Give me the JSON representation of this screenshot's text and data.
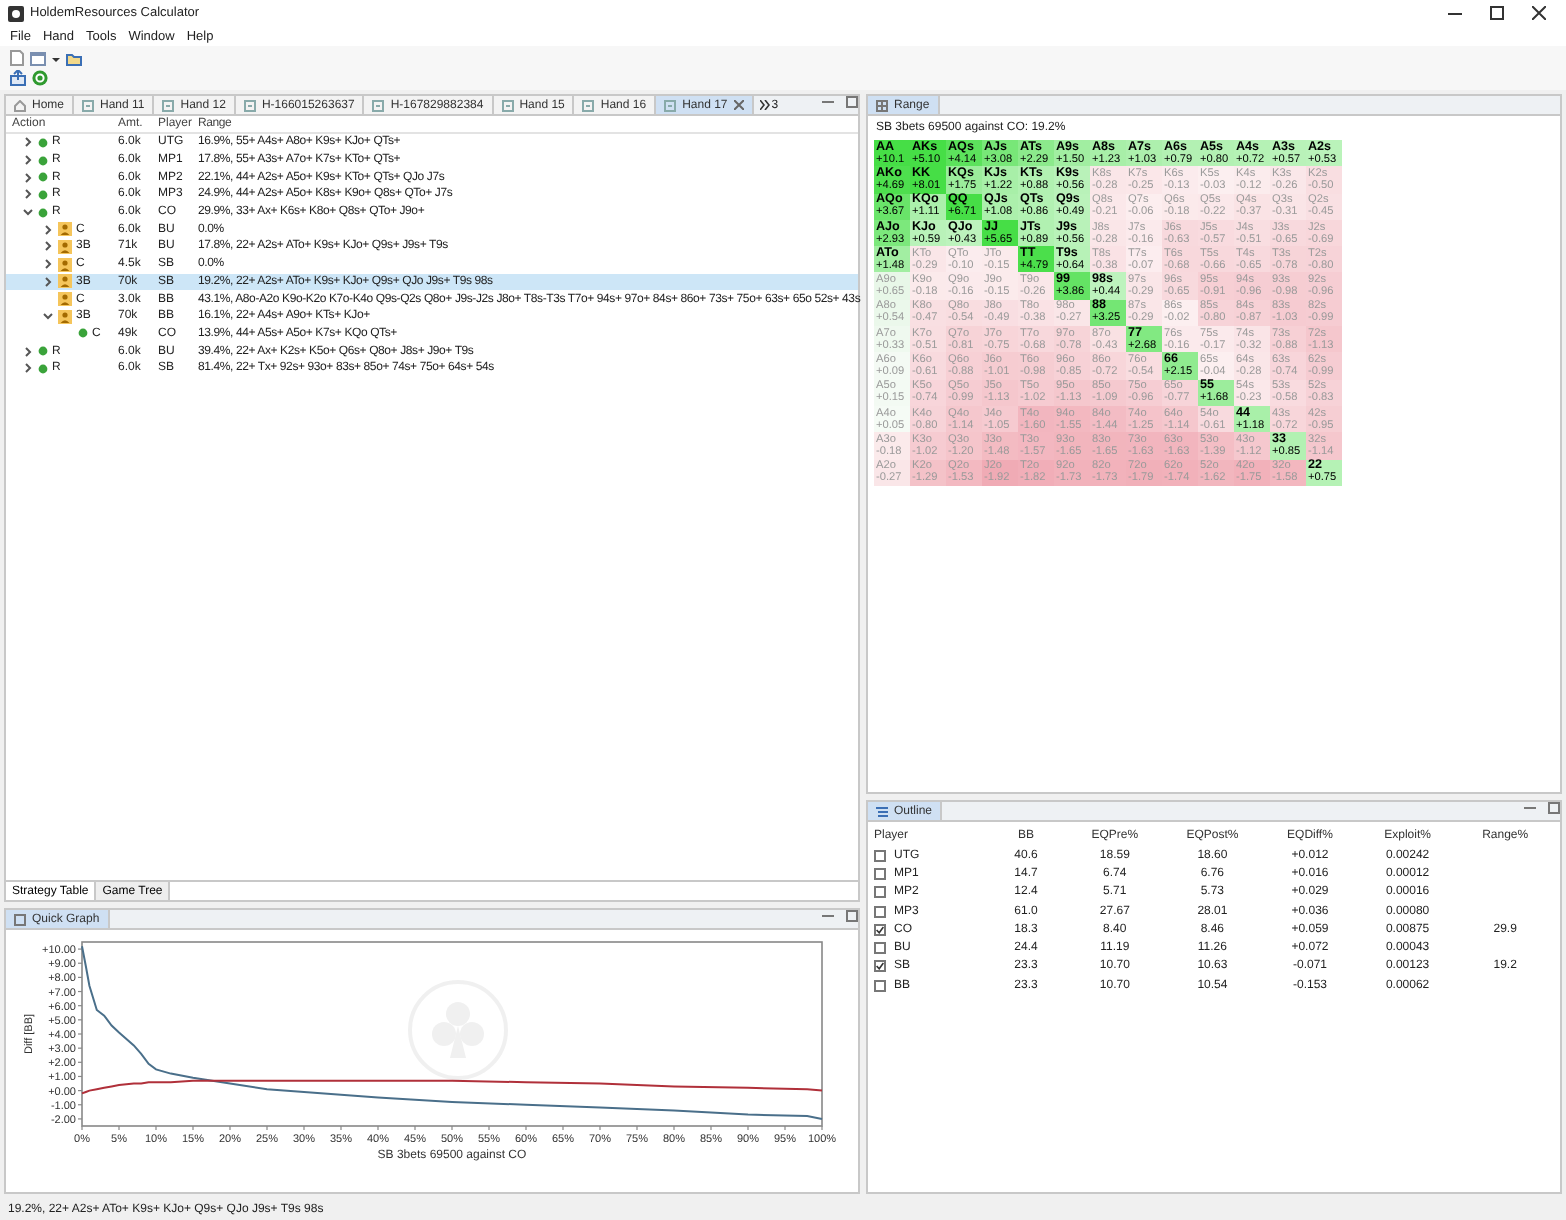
{
  "window": {
    "title": "HoldemResources Calculator"
  },
  "menu": [
    "File",
    "Hand",
    "Tools",
    "Window",
    "Help"
  ],
  "tabs": [
    {
      "label": "Home",
      "selected": false
    },
    {
      "label": "Hand 11",
      "selected": false
    },
    {
      "label": "Hand 12",
      "selected": false
    },
    {
      "label": "H-166015263637",
      "selected": false
    },
    {
      "label": "H-167829882384",
      "selected": false
    },
    {
      "label": "Hand 15",
      "selected": false
    },
    {
      "label": "Hand 16",
      "selected": false
    },
    {
      "label": "Hand 17",
      "selected": true
    }
  ],
  "tab_overflow": "3",
  "strategy_table": {
    "columns": [
      "Action",
      "Amt.",
      "Player",
      "Range"
    ],
    "rows": [
      {
        "kind": "dot",
        "action": "R",
        "amt": "6.0k",
        "player": "UTG",
        "range": "16.9%, 55+ A4s+ A8o+ K9s+ KJo+ QTs+",
        "expanded": false,
        "selected": false
      },
      {
        "kind": "dot",
        "action": "R",
        "amt": "6.0k",
        "player": "MP1",
        "range": "17.8%, 55+ A3s+ A7o+ K7s+ KTo+ QTs+",
        "expanded": false,
        "selected": false
      },
      {
        "kind": "dot",
        "action": "R",
        "amt": "6.0k",
        "player": "MP2",
        "range": "22.1%, 44+ A2s+ A5o+ K9s+ KTo+ QTs+ QJo J7s",
        "expanded": false,
        "selected": false
      },
      {
        "kind": "dot",
        "action": "R",
        "amt": "6.0k",
        "player": "MP3",
        "range": "24.9%, 44+ A2s+ A5o+ K8s+ K9o+ Q8s+ QTo+ J7s",
        "expanded": false,
        "selected": false
      },
      {
        "kind": "dot",
        "action": "R",
        "amt": "6.0k",
        "player": "CO",
        "range": "29.9%, 33+ Ax+ K6s+ K8o+ Q8s+ QTo+ J9o+",
        "expanded": true,
        "selected": false,
        "children": [
          {
            "kind": "person",
            "action": "C",
            "amt": "6.0k",
            "player": "BU",
            "range": "0.0%",
            "expanded": false,
            "selected": false
          },
          {
            "kind": "person",
            "action": "3B",
            "amt": "71k",
            "player": "BU",
            "range": "17.8%, 22+ A2s+ ATo+ K9s+ KJo+ Q9s+ J9s+ T9s",
            "expanded": false,
            "selected": false
          },
          {
            "kind": "person",
            "action": "C",
            "amt": "4.5k",
            "player": "SB",
            "range": "0.0%",
            "expanded": false,
            "selected": false
          },
          {
            "kind": "person",
            "action": "3B",
            "amt": "70k",
            "player": "SB",
            "range": "19.2%, 22+ A2s+ ATo+ K9s+ KJo+ Q9s+ QJo J9s+ T9s 98s",
            "expanded": false,
            "selected": true
          },
          {
            "kind": "person",
            "action": "C",
            "amt": "3.0k",
            "player": "BB",
            "range": "43.1%, A8o-A2o K9o-K2o K7o-K4o Q9s-Q2s Q8o+ J9s-J2s J8o+ T8s-T3s T7o+ 94s+ 97o+ 84s+ 86o+ 73s+ 75o+ 63s+ 65o 52s+ 43s",
            "selected": false
          },
          {
            "kind": "person",
            "action": "3B",
            "amt": "70k",
            "player": "BB",
            "range": "16.1%, 22+ A4s+ A9o+ KTs+ KJo+",
            "expanded": true,
            "selected": false,
            "children": [
              {
                "kind": "dot",
                "action": "C",
                "amt": "49k",
                "player": "CO",
                "range": "13.9%, 44+ A5s+ A5o+ K7s+ KQo QTs+",
                "selected": false
              }
            ]
          }
        ]
      },
      {
        "kind": "dot",
        "action": "R",
        "amt": "6.0k",
        "player": "BU",
        "range": "39.4%, 22+ Ax+ K2s+ K5o+ Q6s+ Q8o+ J8s+ J9o+ T9s",
        "expanded": false,
        "selected": false
      },
      {
        "kind": "dot",
        "action": "R",
        "amt": "6.0k",
        "player": "SB",
        "range": "81.4%, 22+ Tx+ 92s+ 93o+ 83s+ 85o+ 74s+ 75o+ 64s+ 54s",
        "expanded": false,
        "selected": false
      }
    ]
  },
  "bottom_tabs": [
    {
      "label": "Strategy Table",
      "selected": true
    },
    {
      "label": "Game Tree",
      "selected": false
    }
  ],
  "quick_graph": {
    "title": "Quick Graph",
    "chart_data": {
      "type": "line",
      "xlabel": "SB 3bets 69500 against CO",
      "ylabel": "Diff [BB]",
      "xlim": [
        0,
        100
      ],
      "ylim": [
        -2.5,
        10.5
      ],
      "xticks": [
        {
          "value": 0,
          "label": "0%"
        },
        {
          "value": 5,
          "label": "5%"
        },
        {
          "value": 10,
          "label": "10%"
        },
        {
          "value": 15,
          "label": "15%"
        },
        {
          "value": 20,
          "label": "20%"
        },
        {
          "value": 25,
          "label": "25%"
        },
        {
          "value": 30,
          "label": "30%"
        },
        {
          "value": 35,
          "label": "35%"
        },
        {
          "value": 40,
          "label": "40%"
        },
        {
          "value": 45,
          "label": "45%"
        },
        {
          "value": 50,
          "label": "50%"
        },
        {
          "value": 55,
          "label": "55%"
        },
        {
          "value": 60,
          "label": "60%"
        },
        {
          "value": 65,
          "label": "65%"
        },
        {
          "value": 70,
          "label": "70%"
        },
        {
          "value": 75,
          "label": "75%"
        },
        {
          "value": 80,
          "label": "80%"
        },
        {
          "value": 85,
          "label": "85%"
        },
        {
          "value": 90,
          "label": "90%"
        },
        {
          "value": 95,
          "label": "95%"
        },
        {
          "value": 100,
          "label": "100%"
        }
      ],
      "yticks": [
        {
          "value": 10,
          "label": "+10.00"
        },
        {
          "value": 9,
          "label": "+9.00"
        },
        {
          "value": 8,
          "label": "+8.00"
        },
        {
          "value": 7,
          "label": "+7.00"
        },
        {
          "value": 6,
          "label": "+6.00"
        },
        {
          "value": 5,
          "label": "+5.00"
        },
        {
          "value": 4,
          "label": "+4.00"
        },
        {
          "value": 3,
          "label": "+3.00"
        },
        {
          "value": 2,
          "label": "+2.00"
        },
        {
          "value": 1,
          "label": "+1.00"
        },
        {
          "value": 0,
          "label": "+0.00"
        },
        {
          "value": -1,
          "label": "-1.00"
        },
        {
          "value": -2,
          "label": "-2.00"
        }
      ],
      "x": [
        0,
        0.5,
        1,
        2,
        3,
        4,
        5,
        7,
        8,
        9,
        10,
        12,
        15,
        20,
        25,
        30,
        40,
        50,
        60,
        70,
        80,
        90,
        98,
        100
      ],
      "series": [
        {
          "color": "#4a6f8a",
          "values": [
            10.2,
            8.8,
            7.4,
            5.7,
            5.3,
            4.6,
            4.1,
            3.2,
            2.6,
            1.9,
            1.5,
            1.2,
            0.9,
            0.5,
            0.1,
            -0.1,
            -0.5,
            -0.8,
            -1.0,
            -1.2,
            -1.4,
            -1.7,
            -1.8,
            -2.0
          ]
        },
        {
          "color": "#b0303a",
          "values": [
            -0.2,
            -0.1,
            0.0,
            0.1,
            0.2,
            0.3,
            0.4,
            0.5,
            0.5,
            0.6,
            0.6,
            0.6,
            0.7,
            0.7,
            0.7,
            0.7,
            0.7,
            0.7,
            0.6,
            0.5,
            0.3,
            0.2,
            0.1,
            0.0
          ]
        }
      ]
    }
  },
  "status_bar": "19.2%, 22+ A2s+ ATo+ K9s+ KJo+ Q9s+ QJo J9s+ T9s 98s",
  "range": {
    "title": "Range",
    "subtitle": "SB 3bets 69500 against CO: 19.2%",
    "grid": [
      [
        {
          "hand": "AA",
          "ev": "+10.1",
          "in_range": true
        },
        {
          "hand": "AKs",
          "ev": "+5.10",
          "in_range": true
        },
        {
          "hand": "AQs",
          "ev": "+4.14",
          "in_range": true
        },
        {
          "hand": "AJs",
          "ev": "+3.08",
          "in_range": true
        },
        {
          "hand": "ATs",
          "ev": "+2.29",
          "in_range": true
        },
        {
          "hand": "A9s",
          "ev": "+1.50",
          "in_range": true
        },
        {
          "hand": "A8s",
          "ev": "+1.23",
          "in_range": true
        },
        {
          "hand": "A7s",
          "ev": "+1.03",
          "in_range": true
        },
        {
          "hand": "A6s",
          "ev": "+0.79",
          "in_range": true
        },
        {
          "hand": "A5s",
          "ev": "+0.80",
          "in_range": true
        },
        {
          "hand": "A4s",
          "ev": "+0.72",
          "in_range": true
        },
        {
          "hand": "A3s",
          "ev": "+0.57",
          "in_range": true
        },
        {
          "hand": "A2s",
          "ev": "+0.53",
          "in_range": true
        }
      ],
      [
        {
          "hand": "AKo",
          "ev": "+4.69",
          "in_range": true
        },
        {
          "hand": "KK",
          "ev": "+8.01",
          "in_range": true
        },
        {
          "hand": "KQs",
          "ev": "+1.75",
          "in_range": true
        },
        {
          "hand": "KJs",
          "ev": "+1.22",
          "in_range": true
        },
        {
          "hand": "KTs",
          "ev": "+0.88",
          "in_range": true
        },
        {
          "hand": "K9s",
          "ev": "+0.56",
          "in_range": true
        },
        {
          "hand": "K8s",
          "ev": "-0.28",
          "in_range": false
        },
        {
          "hand": "K7s",
          "ev": "-0.25",
          "in_range": false
        },
        {
          "hand": "K6s",
          "ev": "-0.13",
          "in_range": false
        },
        {
          "hand": "K5s",
          "ev": "-0.03",
          "in_range": false
        },
        {
          "hand": "K4s",
          "ev": "-0.12",
          "in_range": false
        },
        {
          "hand": "K3s",
          "ev": "-0.26",
          "in_range": false
        },
        {
          "hand": "K2s",
          "ev": "-0.50",
          "in_range": false
        }
      ],
      [
        {
          "hand": "AQo",
          "ev": "+3.67",
          "in_range": true
        },
        {
          "hand": "KQo",
          "ev": "+1.11",
          "in_range": true
        },
        {
          "hand": "QQ",
          "ev": "+6.71",
          "in_range": true
        },
        {
          "hand": "QJs",
          "ev": "+1.08",
          "in_range": true
        },
        {
          "hand": "QTs",
          "ev": "+0.86",
          "in_range": true
        },
        {
          "hand": "Q9s",
          "ev": "+0.49",
          "in_range": true
        },
        {
          "hand": "Q8s",
          "ev": "-0.21",
          "in_range": false
        },
        {
          "hand": "Q7s",
          "ev": "-0.06",
          "in_range": false
        },
        {
          "hand": "Q6s",
          "ev": "-0.18",
          "in_range": false
        },
        {
          "hand": "Q5s",
          "ev": "-0.22",
          "in_range": false
        },
        {
          "hand": "Q4s",
          "ev": "-0.37",
          "in_range": false
        },
        {
          "hand": "Q3s",
          "ev": "-0.31",
          "in_range": false
        },
        {
          "hand": "Q2s",
          "ev": "-0.45",
          "in_range": false
        }
      ],
      [
        {
          "hand": "AJo",
          "ev": "+2.93",
          "in_range": true
        },
        {
          "hand": "KJo",
          "ev": "+0.59",
          "in_range": true
        },
        {
          "hand": "QJo",
          "ev": "+0.43",
          "in_range": true
        },
        {
          "hand": "JJ",
          "ev": "+5.65",
          "in_range": true
        },
        {
          "hand": "JTs",
          "ev": "+0.89",
          "in_range": true
        },
        {
          "hand": "J9s",
          "ev": "+0.56",
          "in_range": true
        },
        {
          "hand": "J8s",
          "ev": "-0.28",
          "in_range": false
        },
        {
          "hand": "J7s",
          "ev": "-0.16",
          "in_range": false
        },
        {
          "hand": "J6s",
          "ev": "-0.63",
          "in_range": false
        },
        {
          "hand": "J5s",
          "ev": "-0.57",
          "in_range": false
        },
        {
          "hand": "J4s",
          "ev": "-0.51",
          "in_range": false
        },
        {
          "hand": "J3s",
          "ev": "-0.65",
          "in_range": false
        },
        {
          "hand": "J2s",
          "ev": "-0.69",
          "in_range": false
        }
      ],
      [
        {
          "hand": "ATo",
          "ev": "+1.48",
          "in_range": true
        },
        {
          "hand": "KTo",
          "ev": "-0.29",
          "in_range": false
        },
        {
          "hand": "QTo",
          "ev": "-0.10",
          "in_range": false
        },
        {
          "hand": "JTo",
          "ev": "-0.15",
          "in_range": false
        },
        {
          "hand": "TT",
          "ev": "+4.79",
          "in_range": true
        },
        {
          "hand": "T9s",
          "ev": "+0.64",
          "in_range": true
        },
        {
          "hand": "T8s",
          "ev": "-0.38",
          "in_range": false
        },
        {
          "hand": "T7s",
          "ev": "-0.07",
          "in_range": false
        },
        {
          "hand": "T6s",
          "ev": "-0.68",
          "in_range": false
        },
        {
          "hand": "T5s",
          "ev": "-0.66",
          "in_range": false
        },
        {
          "hand": "T4s",
          "ev": "-0.65",
          "in_range": false
        },
        {
          "hand": "T3s",
          "ev": "-0.78",
          "in_range": false
        },
        {
          "hand": "T2s",
          "ev": "-0.80",
          "in_range": false
        }
      ],
      [
        {
          "hand": "A9o",
          "ev": "+0.65",
          "in_range": false
        },
        {
          "hand": "K9o",
          "ev": "-0.18",
          "in_range": false
        },
        {
          "hand": "Q9o",
          "ev": "-0.16",
          "in_range": false
        },
        {
          "hand": "J9o",
          "ev": "-0.15",
          "in_range": false
        },
        {
          "hand": "T9o",
          "ev": "-0.26",
          "in_range": false
        },
        {
          "hand": "99",
          "ev": "+3.86",
          "in_range": true
        },
        {
          "hand": "98s",
          "ev": "+0.44",
          "in_range": true
        },
        {
          "hand": "97s",
          "ev": "-0.29",
          "in_range": false
        },
        {
          "hand": "96s",
          "ev": "-0.65",
          "in_range": false
        },
        {
          "hand": "95s",
          "ev": "-0.91",
          "in_range": false
        },
        {
          "hand": "94s",
          "ev": "-0.96",
          "in_range": false
        },
        {
          "hand": "93s",
          "ev": "-0.98",
          "in_range": false
        },
        {
          "hand": "92s",
          "ev": "-0.96",
          "in_range": false
        }
      ],
      [
        {
          "hand": "A8o",
          "ev": "+0.54",
          "in_range": false
        },
        {
          "hand": "K8o",
          "ev": "-0.47",
          "in_range": false
        },
        {
          "hand": "Q8o",
          "ev": "-0.54",
          "in_range": false
        },
        {
          "hand": "J8o",
          "ev": "-0.49",
          "in_range": false
        },
        {
          "hand": "T8o",
          "ev": "-0.38",
          "in_range": false
        },
        {
          "hand": "98o",
          "ev": "-0.27",
          "in_range": false
        },
        {
          "hand": "88",
          "ev": "+3.25",
          "in_range": true
        },
        {
          "hand": "87s",
          "ev": "-0.29",
          "in_range": false
        },
        {
          "hand": "86s",
          "ev": "-0.02",
          "in_range": false
        },
        {
          "hand": "85s",
          "ev": "-0.80",
          "in_range": false
        },
        {
          "hand": "84s",
          "ev": "-0.87",
          "in_range": false
        },
        {
          "hand": "83s",
          "ev": "-1.03",
          "in_range": false
        },
        {
          "hand": "82s",
          "ev": "-0.99",
          "in_range": false
        }
      ],
      [
        {
          "hand": "A7o",
          "ev": "+0.33",
          "in_range": false
        },
        {
          "hand": "K7o",
          "ev": "-0.51",
          "in_range": false
        },
        {
          "hand": "Q7o",
          "ev": "-0.81",
          "in_range": false
        },
        {
          "hand": "J7o",
          "ev": "-0.75",
          "in_range": false
        },
        {
          "hand": "T7o",
          "ev": "-0.68",
          "in_range": false
        },
        {
          "hand": "97o",
          "ev": "-0.78",
          "in_range": false
        },
        {
          "hand": "87o",
          "ev": "-0.43",
          "in_range": false
        },
        {
          "hand": "77",
          "ev": "+2.68",
          "in_range": true
        },
        {
          "hand": "76s",
          "ev": "-0.16",
          "in_range": false
        },
        {
          "hand": "75s",
          "ev": "-0.17",
          "in_range": false
        },
        {
          "hand": "74s",
          "ev": "-0.32",
          "in_range": false
        },
        {
          "hand": "73s",
          "ev": "-0.88",
          "in_range": false
        },
        {
          "hand": "72s",
          "ev": "-1.13",
          "in_range": false
        }
      ],
      [
        {
          "hand": "A6o",
          "ev": "+0.09",
          "in_range": false
        },
        {
          "hand": "K6o",
          "ev": "-0.61",
          "in_range": false
        },
        {
          "hand": "Q6o",
          "ev": "-0.88",
          "in_range": false
        },
        {
          "hand": "J6o",
          "ev": "-1.01",
          "in_range": false
        },
        {
          "hand": "T6o",
          "ev": "-0.98",
          "in_range": false
        },
        {
          "hand": "96o",
          "ev": "-0.85",
          "in_range": false
        },
        {
          "hand": "86o",
          "ev": "-0.72",
          "in_range": false
        },
        {
          "hand": "76o",
          "ev": "-0.54",
          "in_range": false
        },
        {
          "hand": "66",
          "ev": "+2.15",
          "in_range": true
        },
        {
          "hand": "65s",
          "ev": "-0.04",
          "in_range": false
        },
        {
          "hand": "64s",
          "ev": "-0.28",
          "in_range": false
        },
        {
          "hand": "63s",
          "ev": "-0.74",
          "in_range": false
        },
        {
          "hand": "62s",
          "ev": "-0.99",
          "in_range": false
        }
      ],
      [
        {
          "hand": "A5o",
          "ev": "+0.15",
          "in_range": false
        },
        {
          "hand": "K5o",
          "ev": "-0.74",
          "in_range": false
        },
        {
          "hand": "Q5o",
          "ev": "-0.99",
          "in_range": false
        },
        {
          "hand": "J5o",
          "ev": "-1.13",
          "in_range": false
        },
        {
          "hand": "T5o",
          "ev": "-1.02",
          "in_range": false
        },
        {
          "hand": "95o",
          "ev": "-1.13",
          "in_range": false
        },
        {
          "hand": "85o",
          "ev": "-1.09",
          "in_range": false
        },
        {
          "hand": "75o",
          "ev": "-0.96",
          "in_range": false
        },
        {
          "hand": "65o",
          "ev": "-0.77",
          "in_range": false
        },
        {
          "hand": "55",
          "ev": "+1.68",
          "in_range": true
        },
        {
          "hand": "54s",
          "ev": "-0.23",
          "in_range": false
        },
        {
          "hand": "53s",
          "ev": "-0.58",
          "in_range": false
        },
        {
          "hand": "52s",
          "ev": "-0.83",
          "in_range": false
        }
      ],
      [
        {
          "hand": "A4o",
          "ev": "+0.05",
          "in_range": false
        },
        {
          "hand": "K4o",
          "ev": "-0.80",
          "in_range": false
        },
        {
          "hand": "Q4o",
          "ev": "-1.14",
          "in_range": false
        },
        {
          "hand": "J4o",
          "ev": "-1.05",
          "in_range": false
        },
        {
          "hand": "T4o",
          "ev": "-1.60",
          "in_range": false
        },
        {
          "hand": "94o",
          "ev": "-1.55",
          "in_range": false
        },
        {
          "hand": "84o",
          "ev": "-1.44",
          "in_range": false
        },
        {
          "hand": "74o",
          "ev": "-1.25",
          "in_range": false
        },
        {
          "hand": "64o",
          "ev": "-1.14",
          "in_range": false
        },
        {
          "hand": "54o",
          "ev": "-0.61",
          "in_range": false
        },
        {
          "hand": "44",
          "ev": "+1.18",
          "in_range": true
        },
        {
          "hand": "43s",
          "ev": "-0.72",
          "in_range": false
        },
        {
          "hand": "42s",
          "ev": "-0.95",
          "in_range": false
        }
      ],
      [
        {
          "hand": "A3o",
          "ev": "-0.18",
          "in_range": false
        },
        {
          "hand": "K3o",
          "ev": "-1.02",
          "in_range": false
        },
        {
          "hand": "Q3o",
          "ev": "-1.20",
          "in_range": false
        },
        {
          "hand": "J3o",
          "ev": "-1.48",
          "in_range": false
        },
        {
          "hand": "T3o",
          "ev": "-1.57",
          "in_range": false
        },
        {
          "hand": "93o",
          "ev": "-1.65",
          "in_range": false
        },
        {
          "hand": "83o",
          "ev": "-1.65",
          "in_range": false
        },
        {
          "hand": "73o",
          "ev": "-1.63",
          "in_range": false
        },
        {
          "hand": "63o",
          "ev": "-1.63",
          "in_range": false
        },
        {
          "hand": "53o",
          "ev": "-1.39",
          "in_range": false
        },
        {
          "hand": "43o",
          "ev": "-1.12",
          "in_range": false
        },
        {
          "hand": "33",
          "ev": "+0.85",
          "in_range": true
        },
        {
          "hand": "32s",
          "ev": "-1.14",
          "in_range": false
        }
      ],
      [
        {
          "hand": "A2o",
          "ev": "-0.27",
          "in_range": false
        },
        {
          "hand": "K2o",
          "ev": "-1.29",
          "in_range": false
        },
        {
          "hand": "Q2o",
          "ev": "-1.53",
          "in_range": false
        },
        {
          "hand": "J2o",
          "ev": "-1.92",
          "in_range": false
        },
        {
          "hand": "T2o",
          "ev": "-1.82",
          "in_range": false
        },
        {
          "hand": "92o",
          "ev": "-1.73",
          "in_range": false
        },
        {
          "hand": "82o",
          "ev": "-1.73",
          "in_range": false
        },
        {
          "hand": "72o",
          "ev": "-1.79",
          "in_range": false
        },
        {
          "hand": "62o",
          "ev": "-1.74",
          "in_range": false
        },
        {
          "hand": "52o",
          "ev": "-1.62",
          "in_range": false
        },
        {
          "hand": "42o",
          "ev": "-1.75",
          "in_range": false
        },
        {
          "hand": "32o",
          "ev": "-1.58",
          "in_range": false
        },
        {
          "hand": "22",
          "ev": "+0.75",
          "in_range": true
        }
      ]
    ]
  },
  "outline": {
    "title": "Outline",
    "columns": [
      "Player",
      "BB",
      "EQPre%",
      "EQPost%",
      "EQDiff%",
      "Exploit%",
      "Range%"
    ],
    "rows": [
      {
        "checked": false,
        "cells": [
          "UTG",
          "40.6",
          "18.59",
          "18.60",
          "+0.012",
          "0.00242"
        ]
      },
      {
        "checked": false,
        "cells": [
          "MP1",
          "14.7",
          "6.74",
          "6.76",
          "+0.016",
          "0.00012"
        ]
      },
      {
        "checked": false,
        "cells": [
          "MP2",
          "12.4",
          "5.71",
          "5.73",
          "+0.029",
          "0.00016"
        ]
      },
      {
        "checked": false,
        "cells": [
          "MP3",
          "61.0",
          "27.67",
          "28.01",
          "+0.036",
          "0.00080"
        ]
      },
      {
        "checked": true,
        "cells": [
          "CO",
          "18.3",
          "8.40",
          "8.46",
          "+0.059",
          "0.00875",
          "29.9"
        ]
      },
      {
        "checked": false,
        "cells": [
          "BU",
          "24.4",
          "11.19",
          "11.26",
          "+0.072",
          "0.00043"
        ]
      },
      {
        "checked": true,
        "cells": [
          "SB",
          "23.3",
          "10.70",
          "10.63",
          "-0.071",
          "0.00123",
          "19.2"
        ]
      },
      {
        "checked": false,
        "cells": [
          "BB",
          "23.3",
          "10.70",
          "10.54",
          "-0.153",
          "0.00062"
        ]
      }
    ]
  }
}
